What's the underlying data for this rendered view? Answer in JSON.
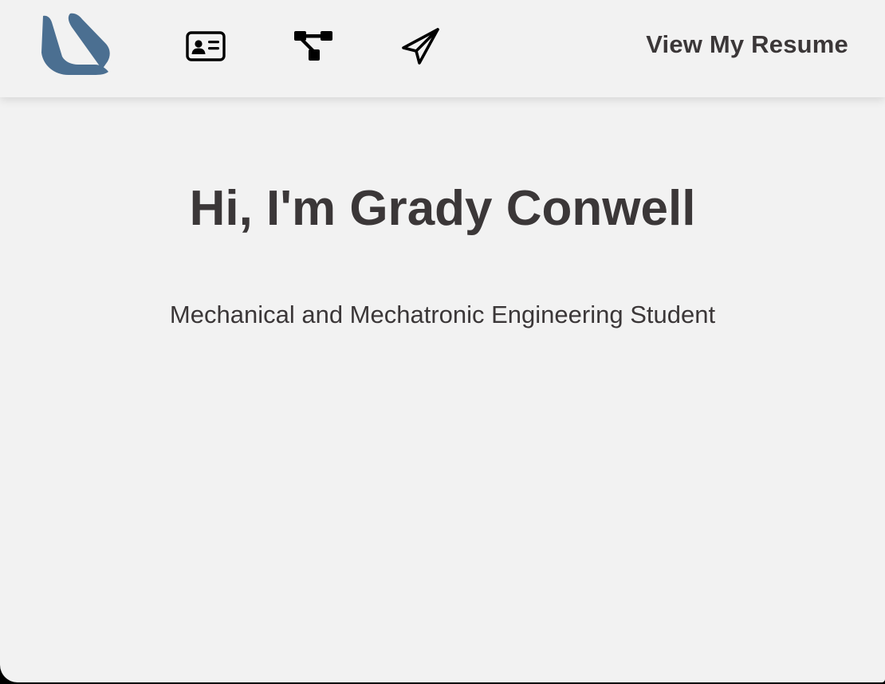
{
  "header": {
    "logo_icon": "brand-logo-icon",
    "nav": [
      {
        "icon": "id-card-icon"
      },
      {
        "icon": "project-tree-icon"
      },
      {
        "icon": "paper-plane-icon"
      }
    ],
    "resume_label": "View My Resume"
  },
  "hero": {
    "title": "Hi, I'm Grady Conwell",
    "subtitle": "Mechanical and Mechatronic Engineering Student"
  },
  "colors": {
    "background": "#f2f2f2",
    "text": "#3b3738",
    "logo": "#4b6f91",
    "icons": "#000000"
  }
}
